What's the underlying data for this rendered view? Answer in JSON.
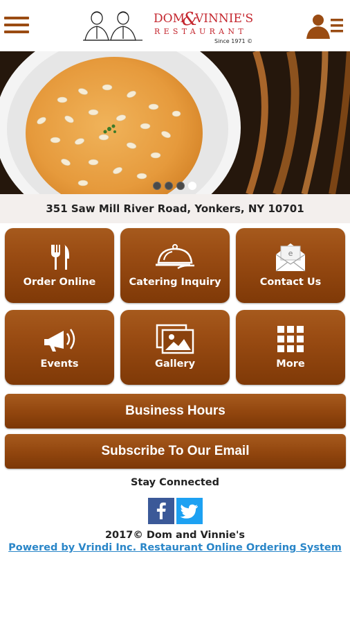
{
  "brand": {
    "name_top": "DOM & VINNIE'S",
    "name_sub": "RESTAURANT",
    "since": "Since 1971 ©"
  },
  "hero": {
    "slide_count": 4,
    "active_slide": 4
  },
  "address": "351 Saw Mill River Road, Yonkers, NY 10701",
  "tiles": [
    {
      "label": "Order Online",
      "icon": "fork-knife-icon"
    },
    {
      "label": "Catering Inquiry",
      "icon": "cloche-icon"
    },
    {
      "label": "Contact Us",
      "icon": "envelope-icon"
    },
    {
      "label": "Events",
      "icon": "megaphone-icon"
    },
    {
      "label": "Gallery",
      "icon": "gallery-icon"
    },
    {
      "label": "More",
      "icon": "grid-icon"
    }
  ],
  "buttons": {
    "business_hours": "Business Hours",
    "subscribe": "Subscribe To Our Email"
  },
  "footer": {
    "stay_connected": "Stay Connected",
    "copyright": "2017© Dom and Vinnie's",
    "powered": "Powered by Vrindi Inc. Restaurant Online Ordering System"
  },
  "colors": {
    "accent": "#9a4c13",
    "logo_red": "#c4262e",
    "facebook": "#3b5998",
    "twitter": "#1da1f2",
    "link": "#2a86c8"
  }
}
